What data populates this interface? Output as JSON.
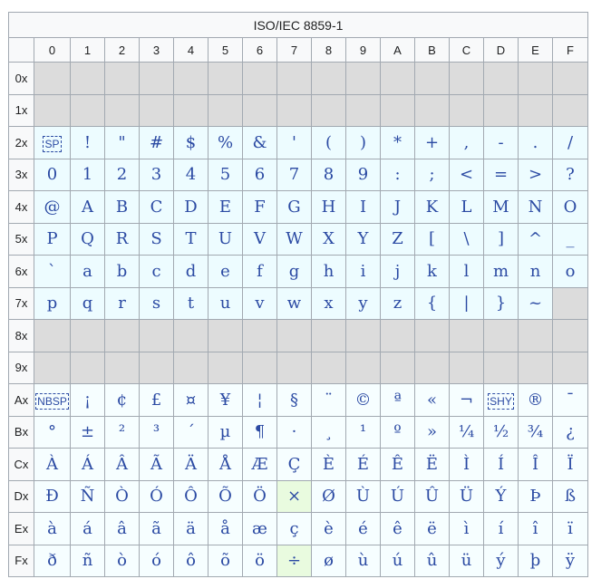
{
  "table": {
    "title": "ISO/IEC 8859-1",
    "columns": [
      "0",
      "1",
      "2",
      "3",
      "4",
      "5",
      "6",
      "7",
      "8",
      "9",
      "A",
      "B",
      "C",
      "D",
      "E",
      "F"
    ],
    "rows": [
      {
        "label": "0x",
        "cells": [
          "",
          "",
          "",
          "",
          "",
          "",
          "",
          "",
          "",
          "",
          "",
          "",
          "",
          "",
          "",
          ""
        ]
      },
      {
        "label": "1x",
        "cells": [
          "",
          "",
          "",
          "",
          "",
          "",
          "",
          "",
          "",
          "",
          "",
          "",
          "",
          "",
          "",
          ""
        ]
      },
      {
        "label": "2x",
        "cells": [
          "SP",
          "!",
          "\"",
          "#",
          "$",
          "%",
          "&",
          "'",
          "(",
          ")",
          "*",
          "+",
          ",",
          "-",
          ".",
          "/"
        ]
      },
      {
        "label": "3x",
        "cells": [
          "0",
          "1",
          "2",
          "3",
          "4",
          "5",
          "6",
          "7",
          "8",
          "9",
          ":",
          ";",
          "<",
          "=",
          ">",
          "?"
        ]
      },
      {
        "label": "4x",
        "cells": [
          "@",
          "A",
          "B",
          "C",
          "D",
          "E",
          "F",
          "G",
          "H",
          "I",
          "J",
          "K",
          "L",
          "M",
          "N",
          "O"
        ]
      },
      {
        "label": "5x",
        "cells": [
          "P",
          "Q",
          "R",
          "S",
          "T",
          "U",
          "V",
          "W",
          "X",
          "Y",
          "Z",
          "[",
          "\\",
          "]",
          "^",
          "_"
        ]
      },
      {
        "label": "6x",
        "cells": [
          "`",
          "a",
          "b",
          "c",
          "d",
          "e",
          "f",
          "g",
          "h",
          "i",
          "j",
          "k",
          "l",
          "m",
          "n",
          "o"
        ]
      },
      {
        "label": "7x",
        "cells": [
          "p",
          "q",
          "r",
          "s",
          "t",
          "u",
          "v",
          "w",
          "x",
          "y",
          "z",
          "{",
          "|",
          "}",
          "~",
          ""
        ]
      },
      {
        "label": "8x",
        "cells": [
          "",
          "",
          "",
          "",
          "",
          "",
          "",
          "",
          "",
          "",
          "",
          "",
          "",
          "",
          "",
          ""
        ]
      },
      {
        "label": "9x",
        "cells": [
          "",
          "",
          "",
          "",
          "",
          "",
          "",
          "",
          "",
          "",
          "",
          "",
          "",
          "",
          "",
          ""
        ]
      },
      {
        "label": "Ax",
        "cells": [
          "NBSP",
          "¡",
          "¢",
          "£",
          "¤",
          "¥",
          "¦",
          "§",
          "¨",
          "©",
          "ª",
          "«",
          "¬",
          "SHY",
          "®",
          "¯"
        ]
      },
      {
        "label": "Bx",
        "cells": [
          "°",
          "±",
          "²",
          "³",
          "´",
          "µ",
          "¶",
          "·",
          "¸",
          "¹",
          "º",
          "»",
          "¼",
          "½",
          "¾",
          "¿"
        ]
      },
      {
        "label": "Cx",
        "cells": [
          "À",
          "Á",
          "Â",
          "Ã",
          "Ä",
          "Å",
          "Æ",
          "Ç",
          "È",
          "É",
          "Ê",
          "Ë",
          "Ì",
          "Í",
          "Î",
          "Ï"
        ]
      },
      {
        "label": "Dx",
        "cells": [
          "Ð",
          "Ñ",
          "Ò",
          "Ó",
          "Ô",
          "Õ",
          "Ö",
          "×",
          "Ø",
          "Ù",
          "Ú",
          "Û",
          "Ü",
          "Ý",
          "Þ",
          "ß"
        ]
      },
      {
        "label": "Ex",
        "cells": [
          "à",
          "á",
          "â",
          "ã",
          "ä",
          "å",
          "æ",
          "ç",
          "è",
          "é",
          "ê",
          "ë",
          "ì",
          "í",
          "î",
          "ï"
        ]
      },
      {
        "label": "Fx",
        "cells": [
          "ð",
          "ñ",
          "ò",
          "ó",
          "ô",
          "õ",
          "ö",
          "÷",
          "ø",
          "ù",
          "ú",
          "û",
          "ü",
          "ý",
          "þ",
          "ÿ"
        ]
      }
    ],
    "dashed_boxed_cells": [
      "SP",
      "NBSP",
      "SHY"
    ],
    "colors": {
      "ascii_fill": "#edfcff",
      "latin1_fill": "#f6feff",
      "control_fill": "#dcdcdc",
      "highlight_fill": "#e9fbdf",
      "header_fill": "#f8f9fa",
      "border": "#a2a9b1",
      "glyph": "#2b4aa3"
    }
  }
}
